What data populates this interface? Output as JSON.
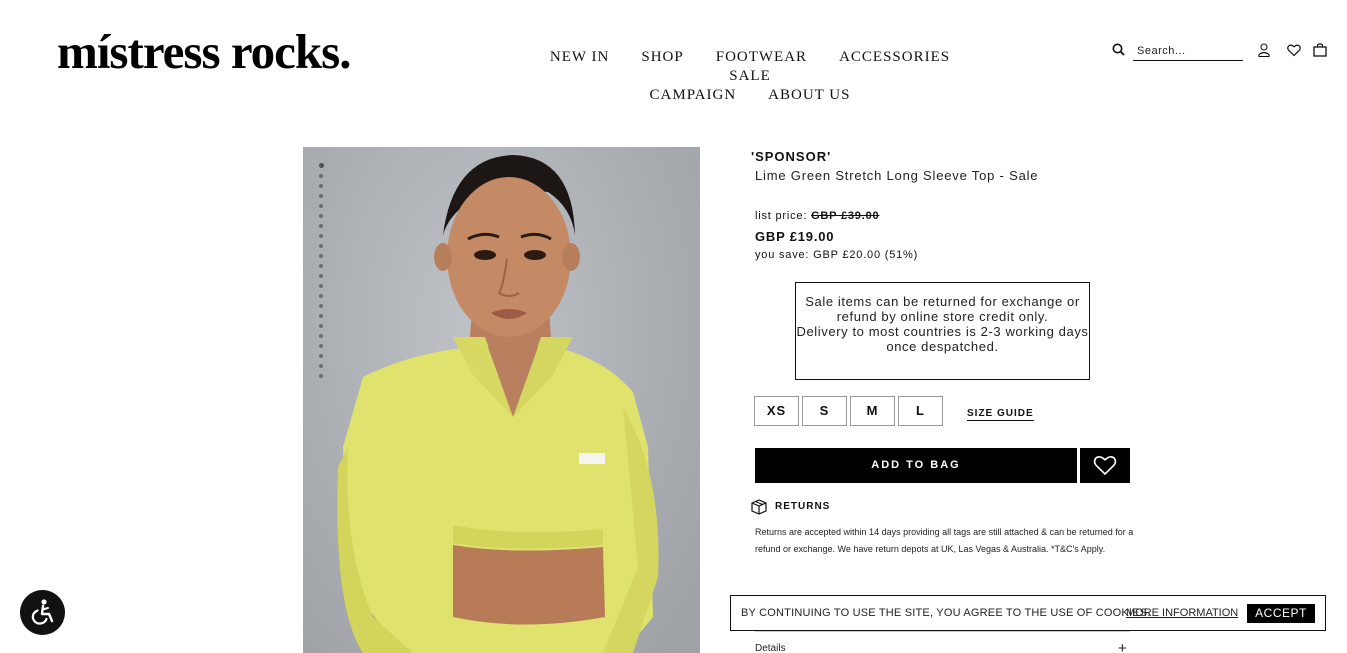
{
  "header": {
    "logo": "místress rocks.",
    "nav": [
      "NEW IN",
      "SHOP",
      "FOOTWEAR",
      "ACCESSORIES",
      "SALE",
      "CAMPAIGN",
      "ABOUT US"
    ],
    "search_placeholder": "Search...",
    "icons": [
      "search-icon",
      "account-icon",
      "wishlist-heart-icon",
      "bag-icon"
    ]
  },
  "product": {
    "brand": "'SPONSOR'",
    "title": "Lime Green Stretch Long Sleeve Top - Sale",
    "list_price_label": "list price:",
    "list_price": "GBP £39.00",
    "sale_price": "GBP £19.00",
    "you_save_label": "you save:",
    "you_save": "GBP £20.00 (51%)",
    "image_subject": "model wearing lime green cropped long sleeve top",
    "gallery_dots": 22,
    "accent_color": "#dfe26d"
  },
  "notice": {
    "line1": "Sale items can be returned for exchange or refund by online store credit only.",
    "line2": "Delivery to most countries is 2-3 working days once despatched."
  },
  "sizes": [
    "XS",
    "S",
    "M",
    "L"
  ],
  "size_guide": "SIZE GUIDE",
  "add_to_bag": "ADD TO BAG",
  "returns": {
    "heading": "RETURNS",
    "text": "Returns are accepted within 14 days providing all tags are still attached & can be returned for a refund or exchange. We have return depots at UK, Las Vegas & Australia. *T&C's Apply."
  },
  "details": {
    "label": "Details",
    "expand": "+"
  },
  "cookie": {
    "message": "BY CONTINUING TO USE THE SITE, YOU AGREE TO THE USE OF COOKIES.",
    "more": "MORE INFORMATION",
    "accept": "ACCEPT"
  },
  "accessibility": {
    "icon": "wheelchair-icon"
  }
}
